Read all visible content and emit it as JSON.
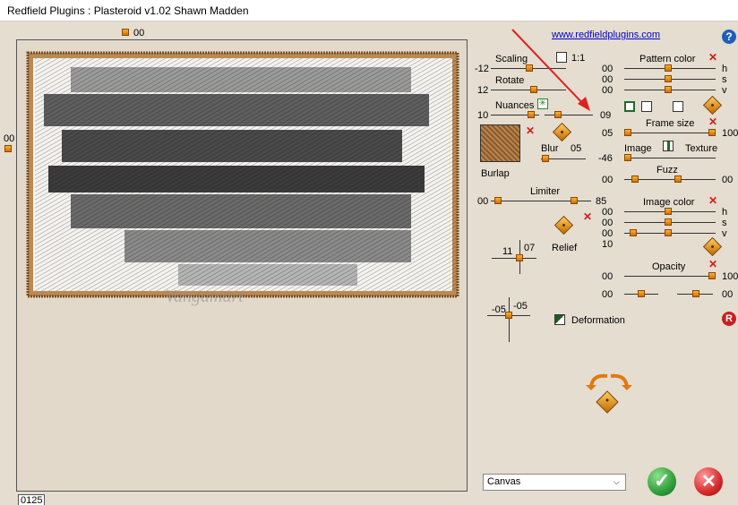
{
  "window": {
    "title": "Redfield Plugins : Plasteroid v1.02   Shawn Madden"
  },
  "preview": {
    "top_value": "00",
    "left_value": "00",
    "bottom_value": "0125",
    "watermark": "Vangamart"
  },
  "link": "www.redfieldplugins.com",
  "help_icon": "?",
  "col1": {
    "scaling": {
      "label": "Scaling",
      "value": "-12"
    },
    "ratio": {
      "label": "1:1"
    },
    "rotate": {
      "label": "Rotate",
      "value": "12"
    },
    "nuances": {
      "label": "Nuances",
      "value1": "10",
      "value2": "09"
    },
    "texture": {
      "name": "Burlap"
    },
    "blur": {
      "label": "Blur",
      "value": "05"
    },
    "limiter": {
      "label": "Limiter",
      "left": "00",
      "right": "85"
    },
    "relief": {
      "label": "Relief",
      "x": "11",
      "y": "07"
    },
    "deformation": {
      "label": "Deformation",
      "x": "-05",
      "y": "-05"
    }
  },
  "col2": {
    "pattern_color": {
      "label": "Pattern color",
      "h": "00",
      "s": "00",
      "v": "00",
      "h_label": "h",
      "s_label": "s",
      "v_label": "v"
    },
    "frame_size": {
      "label": "Frame size",
      "left": "05",
      "right": "100"
    },
    "image_texture": {
      "left_label": "Image",
      "right_label": "Texture",
      "value": "-46"
    },
    "fuzz": {
      "label": "Fuzz",
      "left": "00",
      "right": "00"
    },
    "image_color": {
      "label": "Image color",
      "h": "00",
      "s": "00",
      "v": "00",
      "extra": "10",
      "h_label": "h",
      "s_label": "s",
      "v_label": "v"
    },
    "opacity": {
      "label": "Opacity",
      "left": "00",
      "right": "100",
      "left2": "00",
      "right2": "00"
    }
  },
  "dropdown": {
    "selected": "Canvas"
  },
  "reset_label": "R",
  "colors": {
    "knob": "#f29d2c",
    "ok": "#2f9e3a",
    "cancel": "#d62a2a",
    "link": "#0000cc"
  }
}
